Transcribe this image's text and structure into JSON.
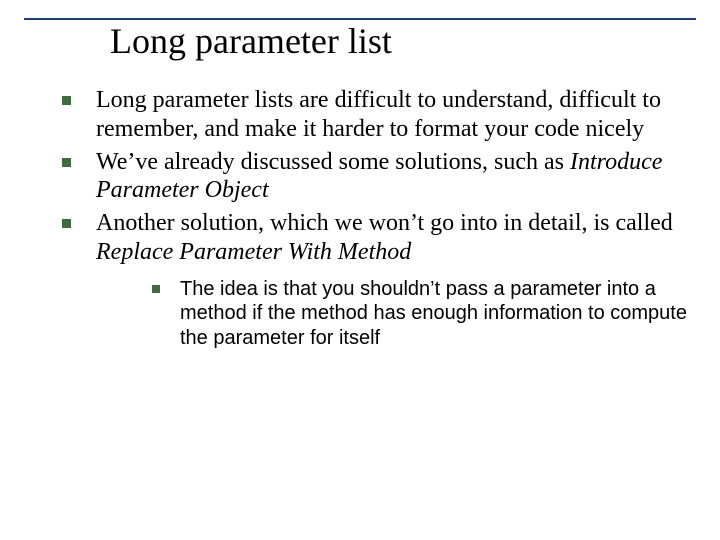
{
  "title": "Long parameter list",
  "bullets": [
    {
      "pre": "Long parameter lists are difficult to understand, difficult to remember, and make it harder to format your code nicely",
      "ital": "",
      "post": ""
    },
    {
      "pre": "We’ve already discussed some solutions, such as ",
      "ital": "Introduce Parameter Object",
      "post": ""
    },
    {
      "pre": "Another solution, which we won’t go into in detail, is called ",
      "ital": "Replace Parameter With Method",
      "post": ""
    }
  ],
  "sub": "The idea is that you shouldn’t pass a parameter into a method if the method has enough information to compute the parameter for itself"
}
